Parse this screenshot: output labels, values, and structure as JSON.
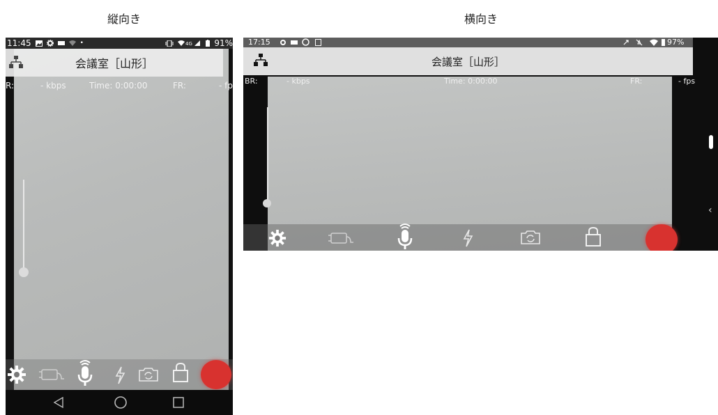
{
  "headings": {
    "portrait": "縦向き",
    "landscape": "横向き"
  },
  "portrait": {
    "status": {
      "time": "11:45",
      "battery": "91%"
    },
    "title": "会議室［山形］",
    "stats": {
      "br_label": "R:",
      "kbps": "- kbps",
      "time": "Time: 0:00:00",
      "fr_label": "FR:",
      "fps": "- fp"
    }
  },
  "landscape": {
    "status": {
      "time": "17:15",
      "battery": "97%"
    },
    "title": "会議室［山形］",
    "stats": {
      "br_label": "BR:",
      "kbps": "- kbps",
      "time": "Time: 0:00:00",
      "fr_label": "FR:",
      "fps": "- fps"
    }
  },
  "icons": [
    "network-icon",
    "settings-gear-icon",
    "camera-toggle-icon",
    "microphone-icon",
    "flash-icon",
    "switch-camera-icon",
    "lock-icon",
    "record-button-icon"
  ],
  "colors": {
    "record": "#d8322f",
    "toolbar": "#6e6e6e",
    "camera_bg": "#bdbfbe"
  }
}
